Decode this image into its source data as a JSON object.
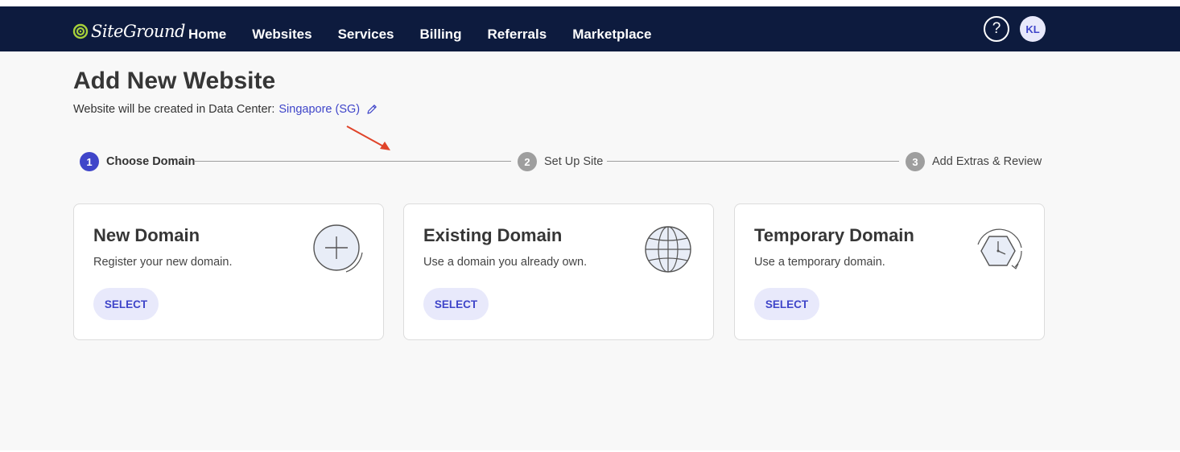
{
  "header": {
    "logo_text": "SiteGround",
    "nav": [
      "Home",
      "Websites",
      "Services",
      "Billing",
      "Referrals",
      "Marketplace"
    ],
    "help_label": "?",
    "avatar_initials": "KL"
  },
  "page": {
    "title": "Add New Website",
    "subtitle_prefix": "Website will be created in Data Center:",
    "datacenter": "Singapore (SG)"
  },
  "steps": [
    {
      "number": "1",
      "label": "Choose Domain",
      "active": true
    },
    {
      "number": "2",
      "label": "Set Up Site",
      "active": false
    },
    {
      "number": "3",
      "label": "Add Extras & Review",
      "active": false
    }
  ],
  "cards": [
    {
      "title": "New Domain",
      "description": "Register your new domain.",
      "button": "SELECT",
      "icon": "plus-circle-icon"
    },
    {
      "title": "Existing Domain",
      "description": "Use a domain you already own.",
      "button": "SELECT",
      "icon": "globe-icon"
    },
    {
      "title": "Temporary Domain",
      "description": "Use a temporary domain.",
      "button": "SELECT",
      "icon": "clock-hexagon-icon"
    }
  ],
  "colors": {
    "header_bg": "#0d1b3e",
    "accent": "#3f45c9",
    "button_bg": "#e8e9fb",
    "annotation_arrow": "#e0442a"
  }
}
